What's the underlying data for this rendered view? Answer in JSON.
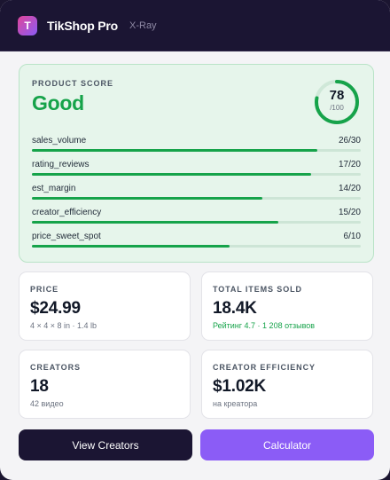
{
  "header": {
    "logo_letter": "T",
    "title": "TikShop Pro",
    "subtitle": "X-Ray"
  },
  "score": {
    "label": "PRODUCT SCORE",
    "rating": "Good",
    "value": "78",
    "max_label": "/100",
    "value_fraction": 0.78,
    "color": "#16a34a",
    "metrics": [
      {
        "name": "sales_volume",
        "score": "26/30",
        "fraction": 0.867
      },
      {
        "name": "rating_reviews",
        "score": "17/20",
        "fraction": 0.85
      },
      {
        "name": "est_margin",
        "score": "14/20",
        "fraction": 0.7
      },
      {
        "name": "creator_efficiency",
        "score": "15/20",
        "fraction": 0.75
      },
      {
        "name": "price_sweet_spot",
        "score": "6/10",
        "fraction": 0.6
      }
    ]
  },
  "cards": {
    "price": {
      "label": "PRICE",
      "value": "$24.99",
      "sub": "4 × 4 × 8 in · 1.4 lb"
    },
    "items_sold": {
      "label": "TOTAL ITEMS SOLD",
      "value": "18.4K",
      "sub": "Рейтинг 4.7 · 1 208 отзывов"
    },
    "creators": {
      "label": "CREATORS",
      "value": "18",
      "sub": "42 видео"
    },
    "efficiency": {
      "label": "CREATOR EFFICIENCY",
      "value": "$1.02K",
      "sub": "на креатора"
    }
  },
  "buttons": {
    "view_creators": "View Creators",
    "calculator": "Calculator"
  },
  "colors": {
    "accent_purple": "#8b5cf6",
    "dark": "#1b1533",
    "good_green": "#16a34a"
  }
}
